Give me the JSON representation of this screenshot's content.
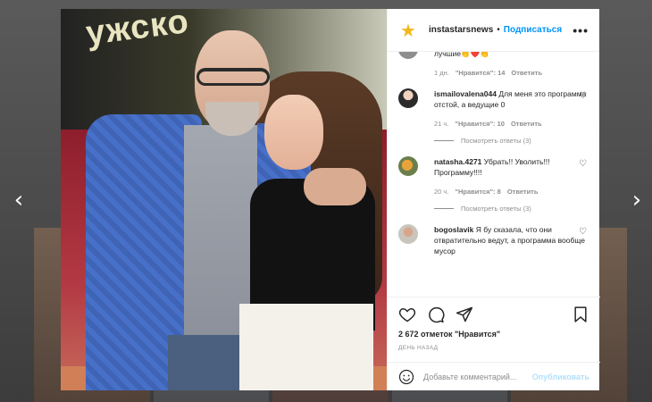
{
  "colors": {
    "accent": "#0095f6",
    "publish_disabled": "#b2dffc",
    "muted": "#8e8e8e",
    "star": "#f1b81c"
  },
  "nav": {
    "prev_icon": "‹",
    "next_icon": "›"
  },
  "post": {
    "photo_text": "ужско",
    "header": {
      "username": "instastarsnews",
      "separator": "•",
      "follow_label": "Подписаться",
      "more_icon": "•••"
    },
    "partial_comment": {
      "text": "лучшие👏❤️👏",
      "time": "1 дн.",
      "likes": "\"Нравится\": 14",
      "reply": "Ответить"
    },
    "comments": [
      {
        "username": "ismailovalena044",
        "text": "Для меня это программа отстой, а ведущие 0",
        "time": "21 ч.",
        "likes": "\"Нравится\": 10",
        "reply": "Ответить",
        "view_replies": "Посмотреть ответы (3)"
      },
      {
        "username": "natasha.4271",
        "text": "Убрать!! Уволить!!! Программу!!!!",
        "time": "20 ч.",
        "likes": "\"Нравится\": 8",
        "reply": "Ответить",
        "view_replies": "Посмотреть ответы (3)"
      },
      {
        "username": "bogoslavik",
        "text": "Я бу сказала, что они отвратительно ведут, а программа вообще мусор"
      }
    ],
    "heart_icon": "♡",
    "likes_count": "2 672 отметок \"Нравится\"",
    "posted": "ДЕНЬ НАЗАД",
    "comment_placeholder": "Добавьте комментарий...",
    "publish_label": "Опубликовать"
  }
}
